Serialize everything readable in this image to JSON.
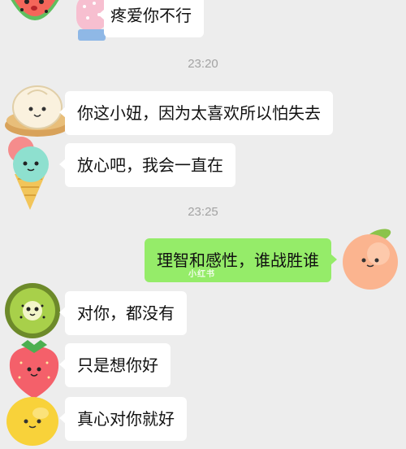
{
  "messages": [
    {
      "text": "疼爱你不行"
    },
    {
      "text": "你这小妞，因为太喜欢所以怕失去"
    },
    {
      "text": "放心吧，我会一直在"
    },
    {
      "text": "理智和感性，谁战胜谁"
    },
    {
      "text": "对你，都没有"
    },
    {
      "text": "只是想你好"
    },
    {
      "text": "真心对你就好"
    }
  ],
  "timestamps": [
    "23:20",
    "23:25"
  ],
  "watermark": "小红书",
  "avatars": [
    {
      "icon": "watermelon-avatar-icon"
    },
    {
      "icon": "glove-avatar-icon"
    },
    {
      "icon": "bun-avatar-icon"
    },
    {
      "icon": "ice-cream-avatar-icon"
    },
    {
      "icon": "peach-avatar-icon"
    },
    {
      "icon": "kiwi-avatar-icon"
    },
    {
      "icon": "strawberry-avatar-icon"
    },
    {
      "icon": "lemon-avatar-icon"
    }
  ],
  "colors": {
    "background": "#ededed",
    "incoming_bubble": "#ffffff",
    "outgoing_bubble": "#95ec69",
    "timestamp_text": "#a3a3a3"
  }
}
